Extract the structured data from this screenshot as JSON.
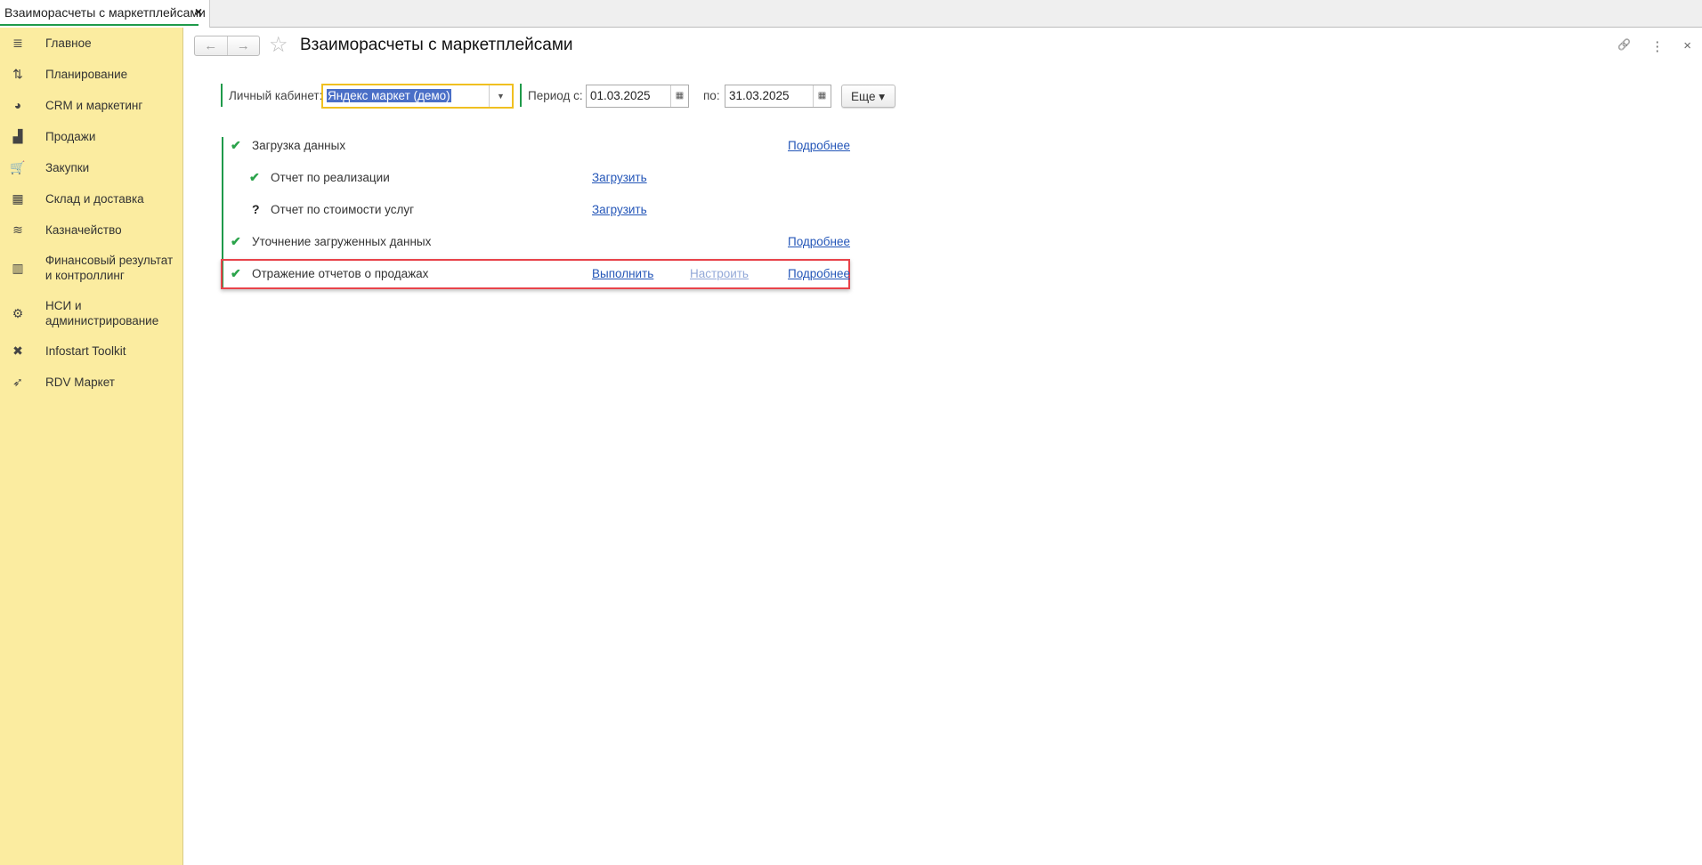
{
  "tab": {
    "title": "Взаиморасчеты с маркетплейсами",
    "close": "×"
  },
  "sidebar": {
    "items": [
      {
        "label": "Главное",
        "icon": "≣"
      },
      {
        "label": "Планирование",
        "icon": "⇅"
      },
      {
        "label": "CRM и маркетинг",
        "icon": "◕"
      },
      {
        "label": "Продажи",
        "icon": "▟"
      },
      {
        "label": "Закупки",
        "icon": "🛒"
      },
      {
        "label": "Склад и доставка",
        "icon": "▦"
      },
      {
        "label": "Казначейство",
        "icon": "≋"
      },
      {
        "label": "Финансовый результат и контроллинг",
        "icon": "▥"
      },
      {
        "label": "НСИ и администрирование",
        "icon": "⚙"
      },
      {
        "label": "Infostart Toolkit",
        "icon": "✖"
      },
      {
        "label": "RDV Маркет",
        "icon": "➶"
      }
    ]
  },
  "header": {
    "title": "Взаиморасчеты с маркетплейсами",
    "back": "←",
    "forward": "→",
    "star": "☆",
    "link_icon": "🔗",
    "more_icon": "⋮",
    "close_icon": "×"
  },
  "filters": {
    "account_label": "Личный кабинет:",
    "account_value": "Яндекс маркет (демо)",
    "period_from_label": "Период с:",
    "period_from": "01.03.2025",
    "period_to_label": "по:",
    "period_to": "31.03.2025",
    "more_button": "Еще ▾"
  },
  "steps": [
    {
      "status": "done",
      "label": "Загрузка данных",
      "details": "Подробнее"
    },
    {
      "status": "done",
      "label": "Отчет по реализации",
      "action": "Загрузить"
    },
    {
      "status": "unknown",
      "label": "Отчет по стоимости услуг",
      "action": "Загрузить"
    },
    {
      "status": "done",
      "label": "Уточнение загруженных данных",
      "details": "Подробнее"
    },
    {
      "status": "done",
      "label": "Отражение отчетов о продажах",
      "action": "Выполнить",
      "configure": "Настроить",
      "details": "Подробнее"
    }
  ],
  "colors": {
    "accent": "#1f9a4a",
    "sidebar": "#fbeca0",
    "highlight": "#e8434a",
    "link": "#2456b8"
  }
}
